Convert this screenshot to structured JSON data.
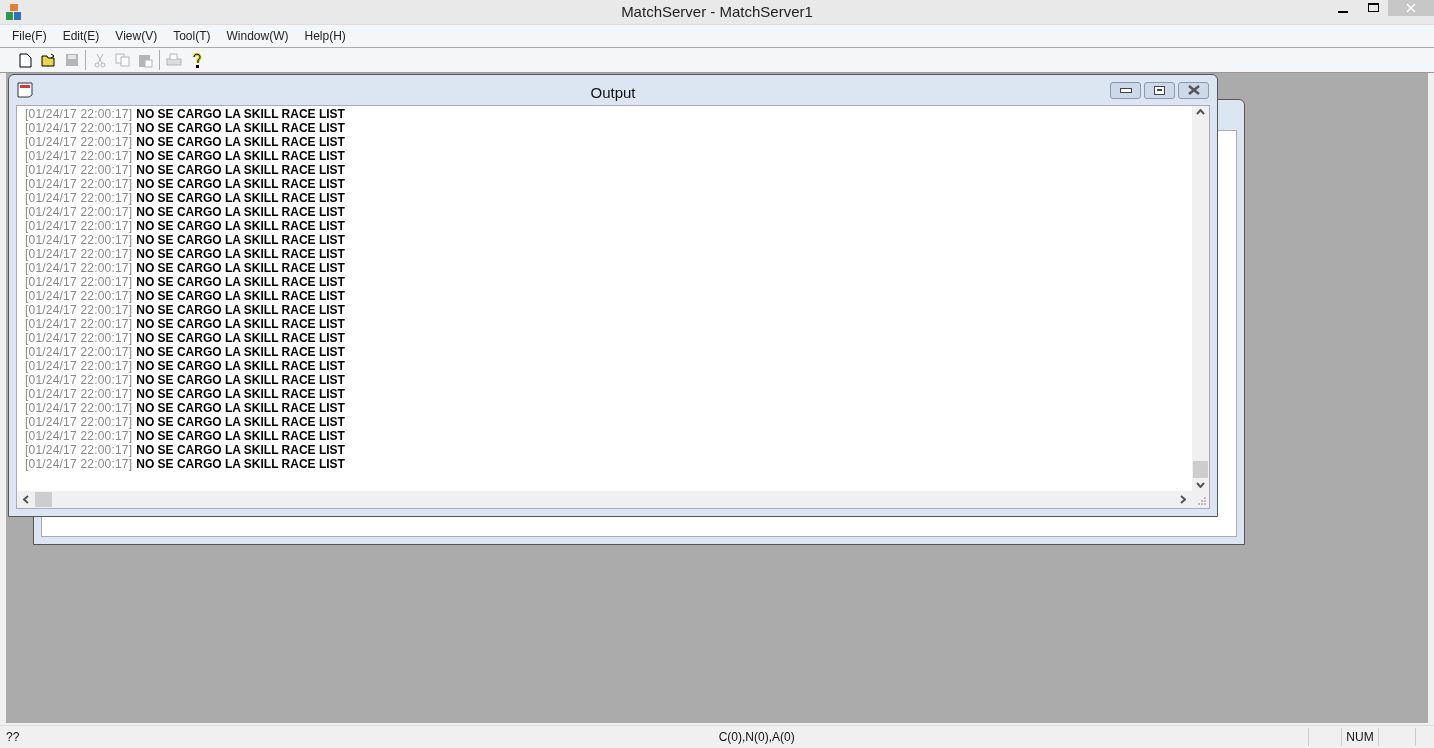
{
  "window": {
    "title": "MatchServer - MatchServer1"
  },
  "menu": [
    "File(F)",
    "Edit(E)",
    "View(V)",
    "Tool(T)",
    "Window(W)",
    "Help(H)"
  ],
  "toolbar": [
    {
      "kind": "new",
      "disabled": false
    },
    {
      "kind": "open",
      "disabled": false
    },
    {
      "kind": "save",
      "disabled": true
    },
    {
      "kind": "sep"
    },
    {
      "kind": "cut",
      "disabled": true
    },
    {
      "kind": "copy",
      "disabled": true
    },
    {
      "kind": "paste",
      "disabled": true
    },
    {
      "kind": "sep"
    },
    {
      "kind": "print",
      "disabled": true
    },
    {
      "kind": "help",
      "disabled": false
    }
  ],
  "output_window": {
    "title": "Output",
    "log": [
      {
        "time": "[01/24/17 22:00:17]",
        "message": "NO SE CARGO LA SKILL RACE LIST"
      },
      {
        "time": "[01/24/17 22:00:17]",
        "message": "NO SE CARGO LA SKILL RACE LIST"
      },
      {
        "time": "[01/24/17 22:00:17]",
        "message": "NO SE CARGO LA SKILL RACE LIST"
      },
      {
        "time": "[01/24/17 22:00:17]",
        "message": "NO SE CARGO LA SKILL RACE LIST"
      },
      {
        "time": "[01/24/17 22:00:17]",
        "message": "NO SE CARGO LA SKILL RACE LIST"
      },
      {
        "time": "[01/24/17 22:00:17]",
        "message": "NO SE CARGO LA SKILL RACE LIST"
      },
      {
        "time": "[01/24/17 22:00:17]",
        "message": "NO SE CARGO LA SKILL RACE LIST"
      },
      {
        "time": "[01/24/17 22:00:17]",
        "message": "NO SE CARGO LA SKILL RACE LIST"
      },
      {
        "time": "[01/24/17 22:00:17]",
        "message": "NO SE CARGO LA SKILL RACE LIST"
      },
      {
        "time": "[01/24/17 22:00:17]",
        "message": "NO SE CARGO LA SKILL RACE LIST"
      },
      {
        "time": "[01/24/17 22:00:17]",
        "message": "NO SE CARGO LA SKILL RACE LIST"
      },
      {
        "time": "[01/24/17 22:00:17]",
        "message": "NO SE CARGO LA SKILL RACE LIST"
      },
      {
        "time": "[01/24/17 22:00:17]",
        "message": "NO SE CARGO LA SKILL RACE LIST"
      },
      {
        "time": "[01/24/17 22:00:17]",
        "message": "NO SE CARGO LA SKILL RACE LIST"
      },
      {
        "time": "[01/24/17 22:00:17]",
        "message": "NO SE CARGO LA SKILL RACE LIST"
      },
      {
        "time": "[01/24/17 22:00:17]",
        "message": "NO SE CARGO LA SKILL RACE LIST"
      },
      {
        "time": "[01/24/17 22:00:17]",
        "message": "NO SE CARGO LA SKILL RACE LIST"
      },
      {
        "time": "[01/24/17 22:00:17]",
        "message": "NO SE CARGO LA SKILL RACE LIST"
      },
      {
        "time": "[01/24/17 22:00:17]",
        "message": "NO SE CARGO LA SKILL RACE LIST"
      },
      {
        "time": "[01/24/17 22:00:17]",
        "message": "NO SE CARGO LA SKILL RACE LIST"
      },
      {
        "time": "[01/24/17 22:00:17]",
        "message": "NO SE CARGO LA SKILL RACE LIST"
      },
      {
        "time": "[01/24/17 22:00:17]",
        "message": "NO SE CARGO LA SKILL RACE LIST"
      },
      {
        "time": "[01/24/17 22:00:17]",
        "message": "NO SE CARGO LA SKILL RACE LIST"
      },
      {
        "time": "[01/24/17 22:00:17]",
        "message": "NO SE CARGO LA SKILL RACE LIST"
      },
      {
        "time": "[01/24/17 22:00:17]",
        "message": "NO SE CARGO LA SKILL RACE LIST"
      },
      {
        "time": "[01/24/17 22:00:17]",
        "message": "NO SE CARGO LA SKILL RACE LIST"
      }
    ]
  },
  "status_bar": {
    "message": "??",
    "counts": "C(0),N(0),A(0)",
    "num": "NUM"
  }
}
